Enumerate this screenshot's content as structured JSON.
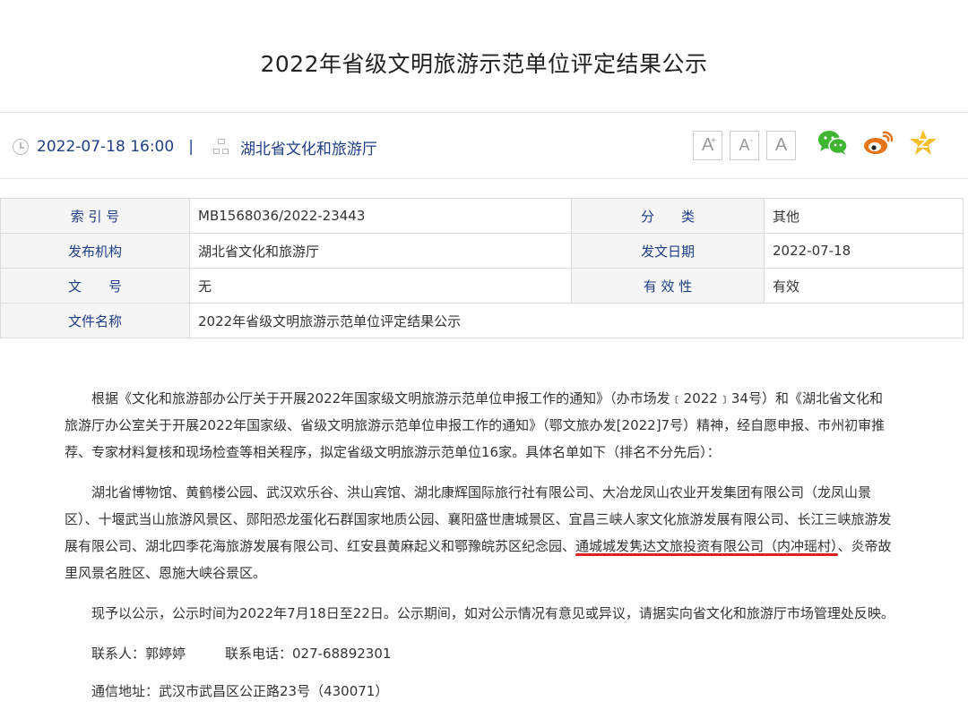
{
  "page": {
    "title": "2022年省级文明旅游示范单位评定结果公示"
  },
  "meta": {
    "date": "2022-07-18 16:00",
    "separator": "|",
    "source": "湖北省文化和旅游厅",
    "font_buttons": [
      "A",
      "A",
      "A"
    ],
    "share_icons": [
      "wechat-icon",
      "weibo-icon",
      "qzone-icon"
    ]
  },
  "info": {
    "index_label": "索 引 号",
    "index_value": "MB1568036/2022-23443",
    "category_label": "分　　类",
    "category_value": "其他",
    "publisher_label": "发布机构",
    "publisher_value": "湖北省文化和旅游厅",
    "date_label": "发文日期",
    "date_value": "2022-07-18",
    "docno_label": "文　　号",
    "docno_value": "无",
    "validity_label": "有 效 性",
    "validity_value": "有效",
    "filename_label": "文件名称",
    "filename_value": "2022年省级文明旅游示范单位评定结果公示"
  },
  "content": {
    "para1": "根据《文化和旅游部办公厅关于开展2022年国家级文明旅游示范单位申报工作的通知》（办市场发﹝2022﹞34号）和《湖北省文化和旅游厅办公室关于开展2022年国家级、省级文明旅游示范单位申报工作的通知》（鄂文旅办发[2022]7号）精神，经自愿申报、市州初审推荐、专家材料复核和现场检查等相关程序，拟定省级文明旅游示范单位16家。具体名单如下（排名不分先后）：",
    "para2_before": "湖北省博物馆、黄鹤楼公园、武汉欢乐谷、洪山宾馆、湖北康辉国际旅行社有限公司、大冶龙凤山农业开发集团有限公司（龙凤山景区）、十堰武当山旅游风景区、郧阳恐龙蛋化石群国家地质公园、襄阳盛世唐城景区、宜昌三峡人家文化旅游发展有限公司、长江三峡旅游发展有限公司、湖北四季花海旅游发展有限公司、红安县黄麻起义和鄂豫皖苏区纪念园、",
    "para2_highlight": "通城城发隽达文旅投资有限公司（内冲瑶村）",
    "para2_after": "、炎帝故里风景名胜区、恩施大峡谷景区。",
    "para3": "现予以公示，公示时间为2022年7月18日至22日。公示期间，如对公示情况有意见或异议，请据实向省文化和旅游厅市场管理处反映。",
    "contact_person": "联系人：郭婷婷",
    "contact_phone": "联系电话：027-68892301",
    "address": "通信地址：武汉市武昌区公正路23号（430071）"
  },
  "colors": {
    "link_blue": "#1f3e86",
    "highlight_red": "#e02020",
    "wechat_green": "#3fb532",
    "weibo_orange": "#e6751a",
    "qzone_yellow": "#f6c02a"
  }
}
